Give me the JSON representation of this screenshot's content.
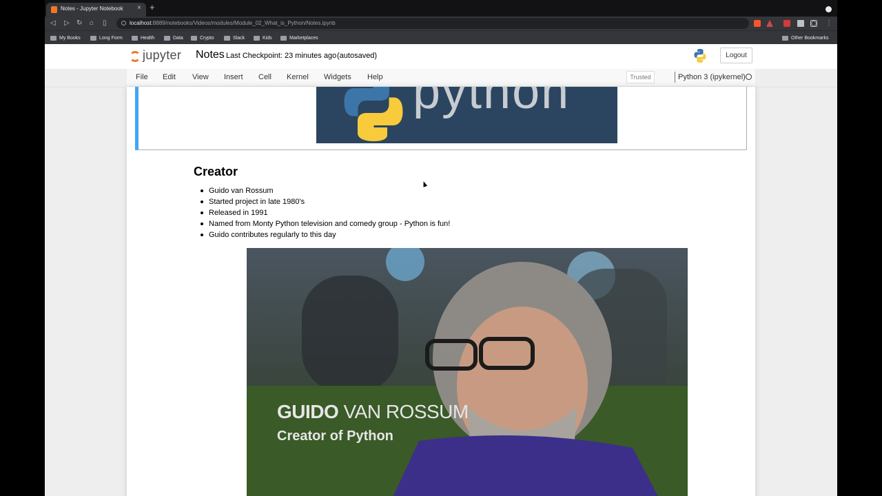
{
  "browser": {
    "tab_title": "Notes - Jupyter Notebook",
    "tab_close": "×",
    "new_tab": "+",
    "url_host": "localhost",
    "url_path": ":8889/notebooks/Videos/modules/Module_02_What_is_Python/Notes.ipynb",
    "nav": {
      "back": "◁",
      "forward": "▷",
      "reload": "↻",
      "home": "⌂",
      "bookmark": "▯"
    },
    "bookmarks": [
      "My Books",
      "Long Form",
      "Health",
      "Data",
      "Crypto",
      "Slack",
      "Kids",
      "Marketplaces"
    ],
    "other_bookmarks": "Other Bookmarks",
    "menu_dots": "⋮"
  },
  "jupyter": {
    "logo_text": "jupyter",
    "notebook_name": "Notes",
    "checkpoint": "Last Checkpoint: 23 minutes ago",
    "autosave": "(autosaved)",
    "logout": "Logout",
    "menu": [
      "File",
      "Edit",
      "View",
      "Insert",
      "Cell",
      "Kernel",
      "Widgets",
      "Help"
    ],
    "trusted": "Trusted",
    "kernel": "Python 3 (ipykernel)"
  },
  "notebook": {
    "banner_text": "python",
    "creator_heading": "Creator",
    "bullets": [
      "Guido van Rossum",
      "Started project in late 1980's",
      "Released in 1991",
      "Named from Monty Python television and comedy group - Python is fun!",
      "Guido contributes regularly to this day"
    ],
    "photo_caption_bold": "GUIDO",
    "photo_caption_thin": " VAN ROSSUM",
    "photo_subcaption": "Creator of Python"
  },
  "colors": {
    "accent": "#42a5f5",
    "jupyter_orange": "#f37726",
    "banner_bg": "#2b4560"
  }
}
